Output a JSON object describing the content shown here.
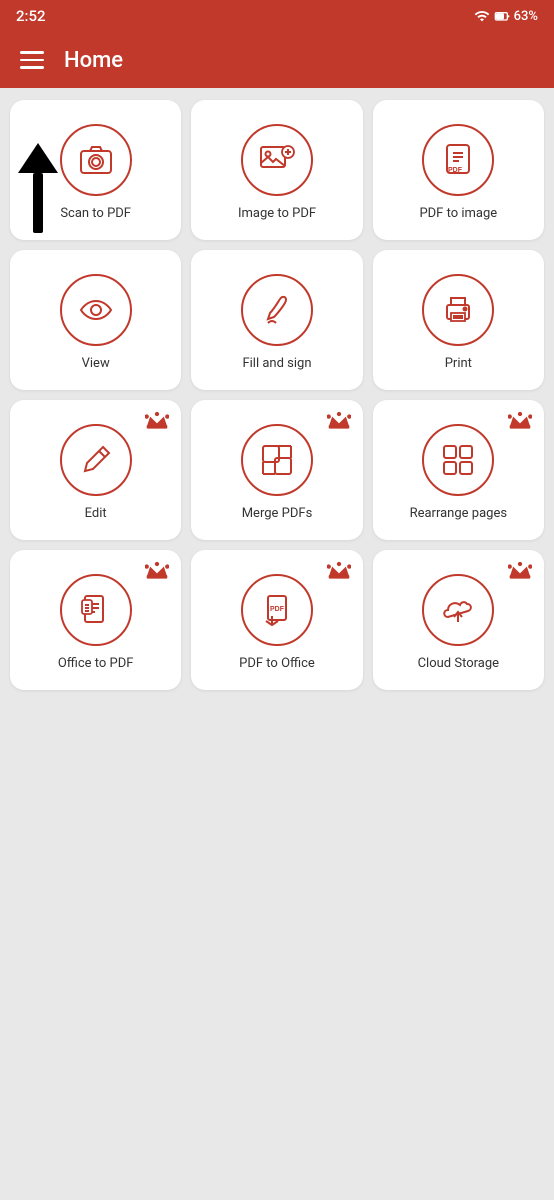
{
  "status_bar": {
    "time": "2:52",
    "battery": "63%"
  },
  "header": {
    "title": "Home",
    "menu_label": "menu"
  },
  "grid": {
    "items": [
      {
        "id": "scan-to-pdf",
        "label": "Scan to PDF",
        "premium": false,
        "icon": "camera"
      },
      {
        "id": "image-to-pdf",
        "label": "Image to PDF",
        "premium": false,
        "icon": "image-to-pdf"
      },
      {
        "id": "pdf-to-image",
        "label": "PDF to image",
        "premium": false,
        "icon": "pdf-to-image"
      },
      {
        "id": "view",
        "label": "View",
        "premium": false,
        "icon": "eye"
      },
      {
        "id": "fill-and-sign",
        "label": "Fill and sign",
        "premium": false,
        "icon": "fill-sign"
      },
      {
        "id": "print",
        "label": "Print",
        "premium": false,
        "icon": "print"
      },
      {
        "id": "edit",
        "label": "Edit",
        "premium": true,
        "icon": "edit"
      },
      {
        "id": "merge-pdfs",
        "label": "Merge PDFs",
        "premium": true,
        "icon": "merge"
      },
      {
        "id": "rearrange-pages",
        "label": "Rearrange pages",
        "premium": true,
        "icon": "rearrange"
      },
      {
        "id": "office-to-pdf",
        "label": "Office to PDF",
        "premium": true,
        "icon": "office-to-pdf"
      },
      {
        "id": "pdf-to-office",
        "label": "PDF to Office",
        "premium": true,
        "icon": "pdf-to-office"
      },
      {
        "id": "cloud-storage",
        "label": "Cloud Storage",
        "premium": true,
        "icon": "cloud"
      }
    ]
  }
}
